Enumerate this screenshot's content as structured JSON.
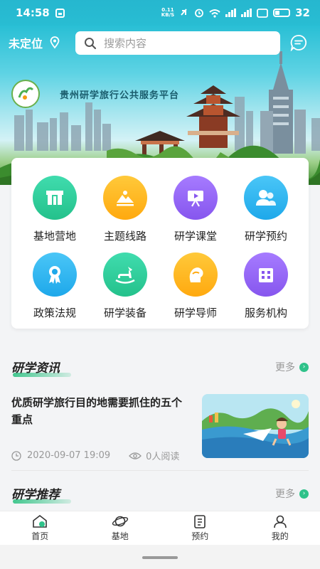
{
  "status_bar": {
    "time": "14:58",
    "net_speed_value": "0.11",
    "net_speed_unit": "KB/S",
    "battery": "32"
  },
  "header": {
    "location": "未定位",
    "search_placeholder": "搜索内容"
  },
  "banner": {
    "platform_title": "贵州研学旅行公共服务平台"
  },
  "grid": [
    {
      "label": "基地营地",
      "icon": "arch-gate-icon",
      "color": "#2fcf98"
    },
    {
      "label": "主题线路",
      "icon": "mountain-icon",
      "color": "#ffb416"
    },
    {
      "label": "研学课堂",
      "icon": "presentation-board-icon",
      "color": "#8e5ff2"
    },
    {
      "label": "研学预约",
      "icon": "users-icon",
      "color": "#27b5f0"
    },
    {
      "label": "政策法规",
      "icon": "award-ribbon-icon",
      "color": "#27b5f0"
    },
    {
      "label": "研学装备",
      "icon": "rocking-horse-icon",
      "color": "#2fcf98"
    },
    {
      "label": "研学导师",
      "icon": "teacher-head-icon",
      "color": "#ffb416"
    },
    {
      "label": "服务机构",
      "icon": "building-icon",
      "color": "#8e5ff2"
    }
  ],
  "news_section": {
    "title": "研学资讯",
    "more": "更多"
  },
  "news": [
    {
      "headline": "优质研学旅行目的地需要抓住的五个重点",
      "date": "2020-09-07 19:09",
      "reads": "0人阅读"
    }
  ],
  "recommend_section": {
    "title": "研学推荐",
    "more": "更多"
  },
  "tabs": [
    {
      "label": "首页",
      "icon": "home-icon",
      "active": true
    },
    {
      "label": "基地",
      "icon": "planet-icon"
    },
    {
      "label": "预约",
      "icon": "clipboard-icon"
    },
    {
      "label": "我的",
      "icon": "user-icon"
    }
  ],
  "colors": {
    "accent": "#2fc28a",
    "status_bar": "#28bdd3"
  }
}
